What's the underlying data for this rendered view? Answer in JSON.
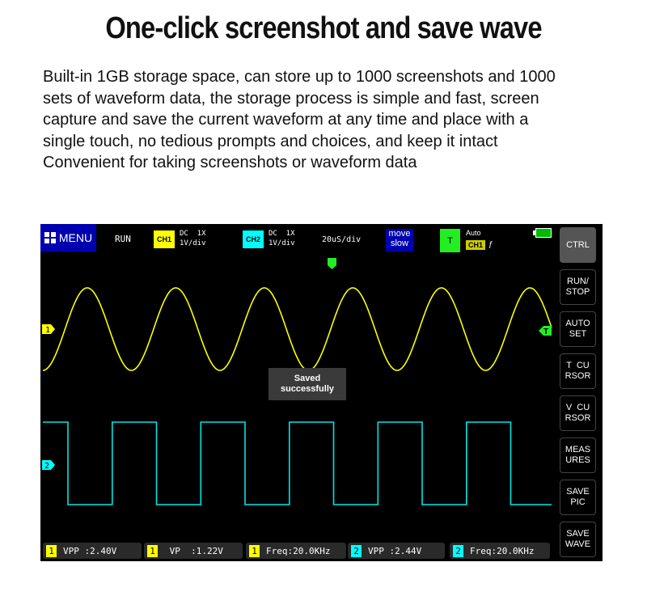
{
  "headline": "One-click screenshot and save wave",
  "description": [
    "Built-in 1GB storage space, can store up to 1000 screenshots and 1000",
    "sets of waveform data, the storage process is simple and fast, screen",
    "capture and save the current waveform at any time and place with a",
    "single touch, no tedious prompts and choices, and keep it intact",
    "Convenient for taking screenshots or waveform data"
  ],
  "scope": {
    "menu_label": "MENU",
    "run_state": "RUN",
    "ch1": {
      "tag": "CH1",
      "info": "DC  1X\n1V/div",
      "color": "#ffff00"
    },
    "ch2": {
      "tag": "CH2",
      "info": "DC  1X\n1V/div",
      "color": "#00ffff"
    },
    "timebase": "20uS/div",
    "move_speed": "move\nslow",
    "trigger": {
      "label": "T",
      "mode": "Auto",
      "source": "CH1",
      "edge": "rising-edge-icon",
      "edge_glyph": "ƒ",
      "color": "#22ee22"
    },
    "battery": "battery-full",
    "toast": "Saved\nsuccessfully",
    "ch1_marker": "1",
    "ch2_marker": "2",
    "trigger_marker": "T",
    "side_buttons": [
      {
        "label": "CTRL",
        "name": "ctrl-button"
      },
      {
        "label": "RUN/\nSTOP",
        "name": "run-stop-button"
      },
      {
        "label": "AUTO\nSET",
        "name": "auto-set-button"
      },
      {
        "label": "T  CU\nRSOR",
        "name": "t-cursor-button"
      },
      {
        "label": "V  CU\nRSOR",
        "name": "v-cursor-button"
      },
      {
        "label": "MEAS\nURES",
        "name": "measures-button"
      },
      {
        "label": "SAVE\nPIC",
        "name": "save-pic-button"
      },
      {
        "label": "SAVE\nWAVE",
        "name": "save-wave-button"
      }
    ],
    "measurements": [
      {
        "channel": "1",
        "text": "VPP :2.40V"
      },
      {
        "channel": "1",
        "text": " VP  :1.22V"
      },
      {
        "channel": "1",
        "text": "Freq:20.0KHz"
      },
      {
        "channel": "2",
        "text": "VPP :2.44V"
      },
      {
        "channel": "2",
        "text": "Freq:20.0KHz"
      }
    ],
    "waveforms": {
      "ch1": {
        "shape": "sine",
        "vpp_volts": 2.4,
        "frequency_khz": 20.0
      },
      "ch2": {
        "shape": "square",
        "vpp_volts": 2.44,
        "frequency_khz": 20.0
      }
    }
  }
}
